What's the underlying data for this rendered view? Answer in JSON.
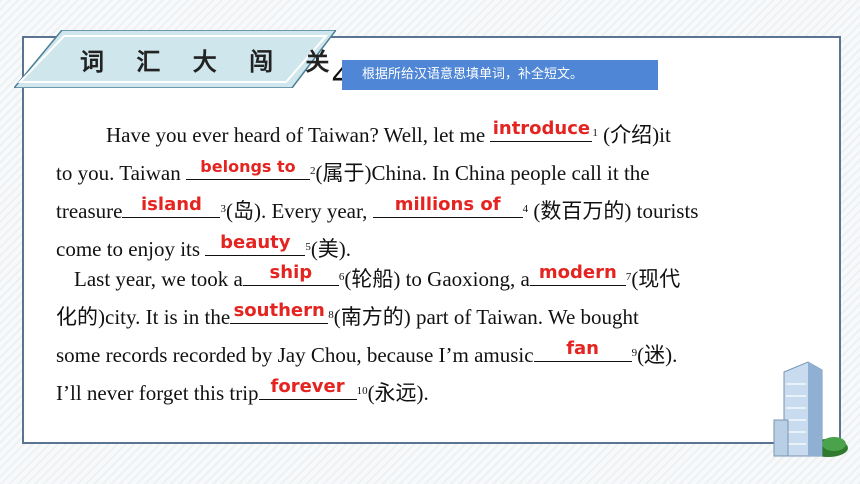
{
  "header": {
    "title": "词 汇 大 闯 关",
    "step": "4",
    "instruction": "根据所给汉语意思填单词，补全短文。"
  },
  "passage": {
    "p1": {
      "t1": "Have you ever heard of Taiwan? Well, let me ",
      "a1": "introduce",
      "n1": "1",
      "h1": " (介绍)it",
      "t2": "to you. Taiwan ",
      "a2": "belongs to",
      "n2": "2",
      "h2": "(属于)China. In China people call it the",
      "t3": "treasure",
      "a3": "island",
      "n3": "3",
      "h3": "(岛). Every year, ",
      "a4": "millions of",
      "n4": "4",
      "h4": " (数百万的) tourists",
      "t5": "come to enjoy its ",
      "a5": "beauty",
      "n5": "5",
      "h5": "(美)."
    },
    "p2": {
      "t6": "Last year, we took a",
      "a6": "ship",
      "n6": "6",
      "h6": "(轮船) to Gaoxiong, a",
      "a7": "modern",
      "n7": "7",
      "h7": "(现代",
      "t8": "化的)city. It is in the",
      "a8": "southern",
      "n8": "8",
      "h8": "(南方的) part of Taiwan. We bought",
      "t9": "some records recorded by Jay Chou, because I’m amusic",
      "a9": "fan",
      "n9": "9",
      "h9": "(迷).",
      "t10": "I’ll never forget this trip",
      "a10": "forever",
      "n10": "10",
      "h10": "(永远)."
    }
  },
  "colors": {
    "answer": "#e42420",
    "instruction_bg": "#4f86d6",
    "frame": "#5a7390"
  }
}
